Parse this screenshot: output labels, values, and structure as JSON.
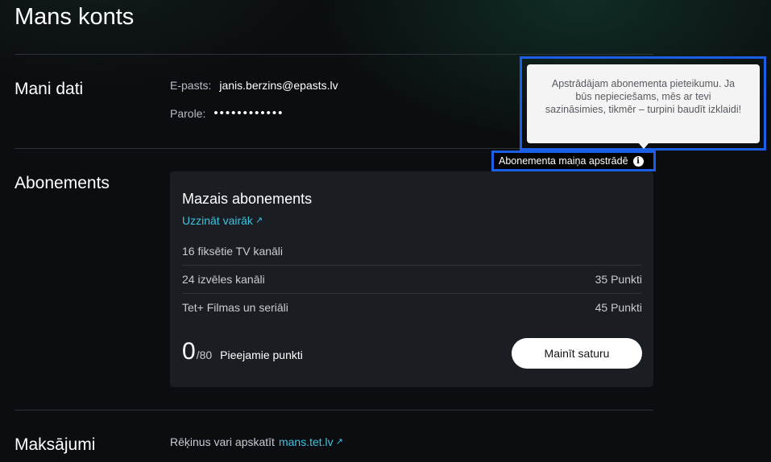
{
  "page": {
    "title": "Mans konts"
  },
  "my_data": {
    "section_title": "Mani dati",
    "email_label": "E-pasts:",
    "email_value": "janis.berzins@epasts.lv",
    "password_label": "Parole:",
    "password_value": "••••••••••••"
  },
  "subscription": {
    "section_title": "Abonements",
    "plan_name": "Mazais abonements",
    "more_link": "Uzzināt vairāk",
    "features": [
      {
        "name": "16 fiksētie TV kanāli",
        "points": ""
      },
      {
        "name": "24 izvēles kanāli",
        "points": "35 Punkti"
      },
      {
        "name": "Tet+ Filmas un seriāli",
        "points": "45 Punkti"
      }
    ],
    "points_used": "0",
    "points_total": "/80",
    "points_label": "Pieejamie punkti",
    "change_button": "Mainīt saturu",
    "status_text": "Abonementa maiņa apstrādē",
    "info_icon_glyph": "i",
    "tooltip_text": "Apstrādājam abonementa pieteikumu. Ja būs nepieciešams, mēs ar tevi sazināsimies, tikmēr – turpini baudīt izklaidi!"
  },
  "payments": {
    "section_title": "Maksājumi",
    "text": "Rēķinus vari apskatīt",
    "link": "mans.tet.lv"
  },
  "icons": {
    "external_link": "↗"
  },
  "colors": {
    "accent_link": "#3cc4e0",
    "highlight_frame": "#1a5fe6",
    "card_background": "#1a1d22",
    "page_background": "#0b0d10"
  }
}
